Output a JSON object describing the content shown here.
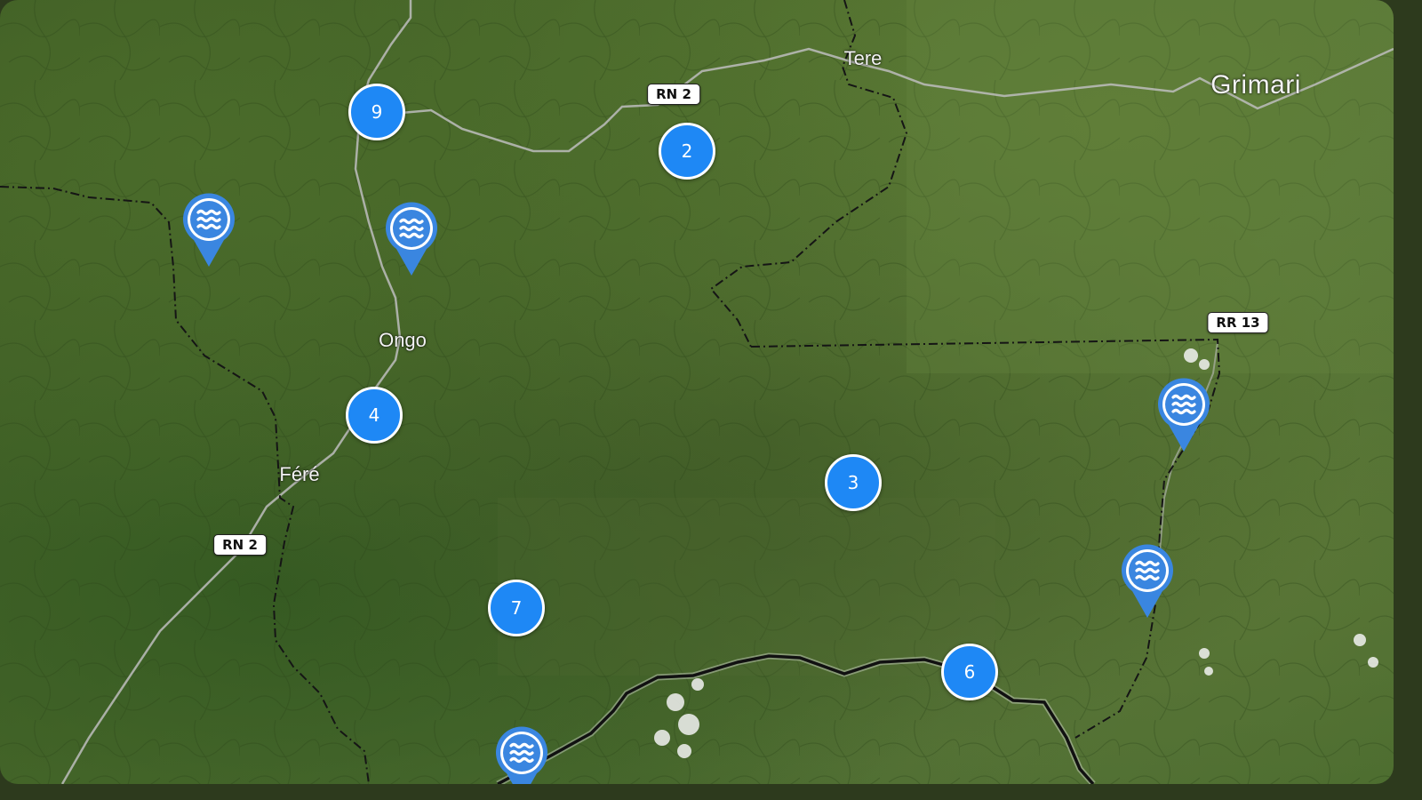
{
  "map": {
    "places": [
      {
        "name": "Tere",
        "size": "small"
      },
      {
        "name": "Grimari",
        "size": "large"
      },
      {
        "name": "Ongo",
        "size": "small"
      },
      {
        "name": "Féré",
        "size": "small"
      }
    ],
    "road_shields": [
      {
        "label": "RN 2"
      },
      {
        "label": "RN 2"
      },
      {
        "label": "RR 13"
      }
    ],
    "clusters": [
      {
        "count": "9"
      },
      {
        "count": "2"
      },
      {
        "count": "4"
      },
      {
        "count": "3"
      },
      {
        "count": "7"
      },
      {
        "count": "6"
      }
    ],
    "water_markers": [
      {
        "icon": "water-waves-icon"
      },
      {
        "icon": "water-waves-icon"
      },
      {
        "icon": "water-waves-icon"
      },
      {
        "icon": "water-waves-icon"
      },
      {
        "icon": "water-waves-icon"
      }
    ]
  },
  "colors": {
    "cluster_fill": "#1e88f5",
    "pin_fill": "#3a86e0",
    "border_line": "#111111",
    "road_line": "#b8b8b8"
  }
}
